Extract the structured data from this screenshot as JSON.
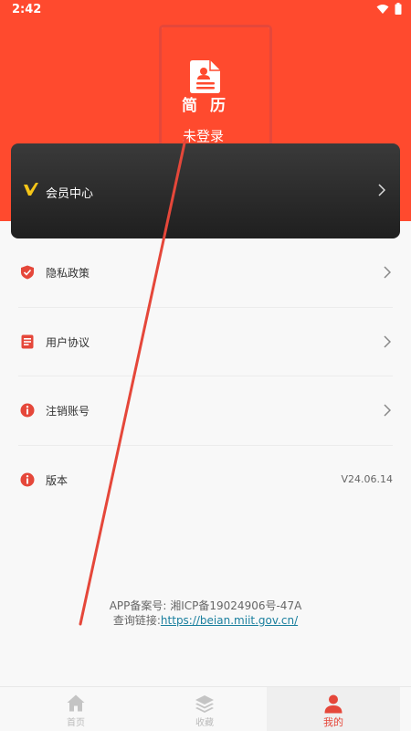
{
  "status_bar": {
    "time": "2:42"
  },
  "profile": {
    "logo_text": "简 历",
    "login_text": "未登录"
  },
  "vip": {
    "label": "会员中心"
  },
  "menu": [
    {
      "label": "隐私政策",
      "icon": "shield-icon"
    },
    {
      "label": "用户协议",
      "icon": "document-icon"
    },
    {
      "label": "注销账号",
      "icon": "info-icon"
    },
    {
      "label": "版本",
      "icon": "info-icon",
      "value": "V24.06.14"
    }
  ],
  "filing": {
    "record": "APP备案号: 湘ICP备19024906号-47A",
    "query_label": "查询链接:",
    "query_link": "https://beian.miit.gov.cn/"
  },
  "tabs": [
    {
      "label": "首页",
      "icon": "home-icon",
      "active": false
    },
    {
      "label": "收藏",
      "icon": "layers-icon",
      "active": false
    },
    {
      "label": "我的",
      "icon": "user-icon",
      "active": true
    }
  ],
  "colors": {
    "accent": "#ff4a2e",
    "brand_red": "#e5473a",
    "vip_gold": "#f5c518",
    "link": "#1a7f9e"
  }
}
